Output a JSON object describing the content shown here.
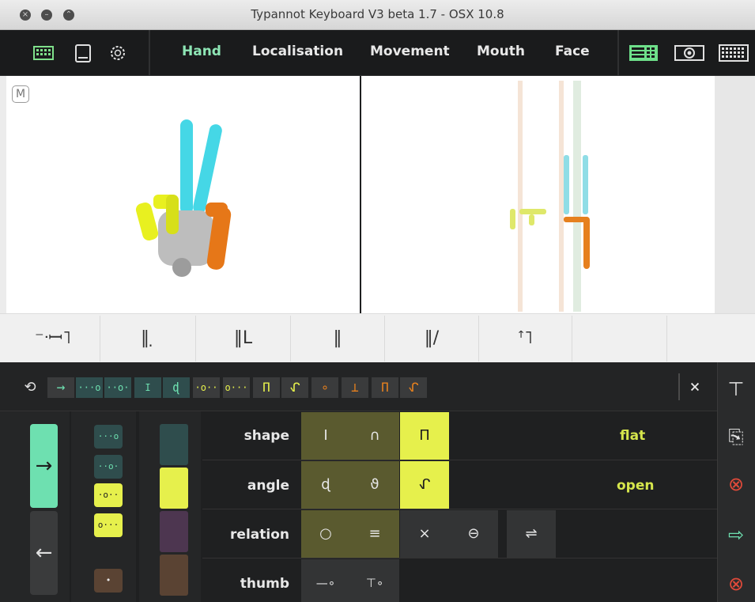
{
  "window": {
    "title": "Typannot Keyboard V3 beta 1.7 - OSX 10.8"
  },
  "toolbar": {
    "left_icons": [
      "keyboard-icon",
      "book-icon",
      "gear-icon"
    ],
    "tabs": [
      {
        "label": "Hand",
        "active": true
      },
      {
        "label": "Localisation",
        "active": false
      },
      {
        "label": "Movement",
        "active": false
      },
      {
        "label": "Mouth",
        "active": false
      },
      {
        "label": "Face",
        "active": false
      }
    ],
    "right_icons": [
      "list-view-icon",
      "target-icon",
      "grid-view-icon"
    ]
  },
  "viewport": {
    "mode_badge": "M"
  },
  "history": {
    "cells": [
      "⁻ᐧꟷ˥",
      "‖ ̣",
      "‖L",
      "‖",
      "‖/",
      "ꜛ˥"
    ]
  },
  "sequence": {
    "refresh_icon": "refresh-icon",
    "items": [
      "→",
      "···o",
      "··o·",
      "I",
      "ɖ",
      "·o··",
      "o···",
      "Π",
      "ᖋ",
      "∘",
      "⊥",
      "Π",
      "ᖋ"
    ],
    "close_label": "×"
  },
  "side": {
    "up_arrow": "→",
    "down_arrow": "←",
    "dot_buttons": [
      "···o",
      "··o·",
      "·o··",
      "o···",
      "•"
    ]
  },
  "rows": [
    {
      "label": "shape",
      "cells": [
        "I",
        "∩",
        "Π"
      ],
      "value": "flat"
    },
    {
      "label": "angle",
      "cells": [
        "ɖ",
        "ϑ",
        "ᖋ"
      ],
      "value": "open"
    },
    {
      "label": "relation",
      "cells": [
        "○",
        "≡",
        "×",
        "⊖",
        "⇌"
      ],
      "value": ""
    },
    {
      "label": "thumb",
      "cells": [
        "—∘",
        "⊤∘"
      ],
      "value": ""
    }
  ],
  "colors": {
    "accent_green": "#6ee0b0",
    "accent_yellow": "#e6f04c",
    "olive": "#5a5a2f",
    "teal_dark": "#2f4d4d",
    "purple_dark": "#4d3650",
    "brown_dark": "#5a4333",
    "error_red": "#e04a3a"
  }
}
